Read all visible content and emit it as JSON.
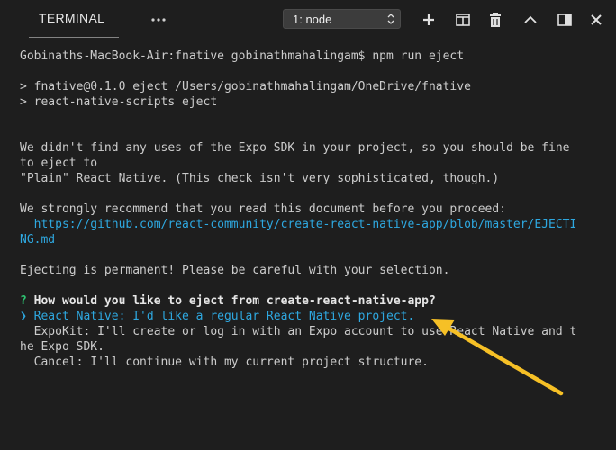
{
  "toolbar": {
    "tab_label": "TERMINAL",
    "terminal_select_value": "1: node",
    "icons": [
      "more-icon",
      "add-icon",
      "split-icon",
      "trash-icon",
      "chevron-up-icon",
      "maximize-icon",
      "close-icon"
    ]
  },
  "terminal": {
    "lines": {
      "l1": "Gobinaths-MacBook-Air:fnative gobinathmahalingam$ npm run eject",
      "l2": "> fnative@0.1.0 eject /Users/gobinathmahalingam/OneDrive/fnative",
      "l3": "> react-native-scripts eject",
      "l4": "We didn't find any uses of the Expo SDK in your project, so you should be fine",
      "l5": "to eject to",
      "l6": "\"Plain\" React Native. (This check isn't very sophisticated, though.)",
      "l7": "We strongly recommend that you read this document before you proceed:",
      "l8": "  https://github.com/react-community/create-react-native-app/blob/master/EJECTI",
      "l9": "NG.md",
      "l10": "Ejecting is permanent! Please be careful with your selection.",
      "q_mark": "?",
      "q_text": " How would you like to eject from create-react-native-app?",
      "opt1": "❯ React Native: I'd like a regular React Native project.",
      "opt2": "  ExpoKit: I'll create or log in with an Expo account to use React Native and t",
      "opt2b": "he Expo SDK.",
      "opt3": "  Cancel: I'll continue with my current project structure."
    }
  },
  "colors": {
    "background": "#1e1e1e",
    "text": "#cccccc",
    "link": "#2ea8e0",
    "prompt_green": "#2ec271",
    "annotation_arrow": "#f6c026"
  }
}
